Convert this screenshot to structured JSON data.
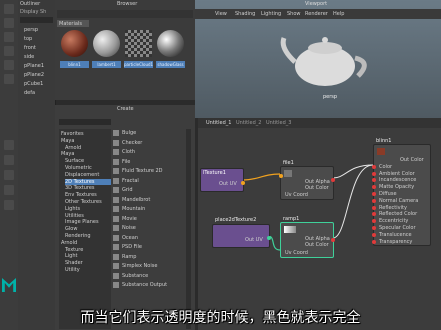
{
  "outliner": {
    "title": "Outliner",
    "menu": [
      "Display",
      "Sh"
    ],
    "items": [
      "persp",
      "top",
      "front",
      "side",
      "pPlane1",
      "pPlane2",
      "pCube1",
      "defa"
    ]
  },
  "browser": {
    "title": "Browser",
    "tab": "Materials",
    "swatches": [
      "blinn1",
      "lambert1",
      "particleCloud1",
      "shadowGlass"
    ]
  },
  "viewport": {
    "title": "Viewport",
    "menu": [
      "View",
      "Shading",
      "Lighting",
      "Show",
      "Renderer",
      "Help"
    ],
    "label": "persp"
  },
  "create": {
    "title": "Create",
    "categories": [
      "Favorites",
      "Maya",
      "Arnold",
      "Maya",
      "Surface",
      "Volumetric",
      "Displacement",
      "2D Textures",
      "3D Textures",
      "Env Textures",
      "Other Textures",
      "Lights",
      "Utilities",
      "Image Planes",
      "Glow",
      "Rendering",
      "Arnold",
      "Texture",
      "Light",
      "Shader",
      "Utility"
    ],
    "nodes": [
      "Bulge",
      "Checker",
      "Cloth",
      "File",
      "Fluid Texture 2D",
      "Fractal",
      "Grid",
      "Mandelbrot",
      "Mountain",
      "Movie",
      "Noise",
      "Ocean",
      "PSD File",
      "Ramp",
      "Simplex Noise",
      "Substance",
      "Substance Output"
    ]
  },
  "nodeeditor": {
    "tabs": [
      "Untitled_1",
      "Untitled_2",
      "Untitled_3"
    ],
    "nodes": {
      "texture": {
        "name": "lTexture1",
        "attrs": [
          "Out UV"
        ]
      },
      "file": {
        "name": "file1",
        "attrs": [
          "Out Alpha",
          "Out Color",
          "Uv Coord"
        ]
      },
      "place": {
        "name": "place2dTexture2",
        "attrs": [
          "Out UV"
        ]
      },
      "ramp": {
        "name": "ramp1",
        "attrs": [
          "Out Alpha",
          "Out Color",
          "Uv Coord"
        ]
      },
      "blinn": {
        "name": "blinn1",
        "attrs": [
          "Out Color",
          "Color",
          "Ambient Color",
          "Incandescence",
          "Matte Opacity",
          "Diffuse",
          "Normal Camera",
          "Reflectivity",
          "Reflected Color",
          "Eccentricity",
          "Specular Color",
          "Translucence",
          "Transparency"
        ]
      }
    }
  },
  "subtitle": "而当它们表示透明度的时候，黑色就表示完全"
}
